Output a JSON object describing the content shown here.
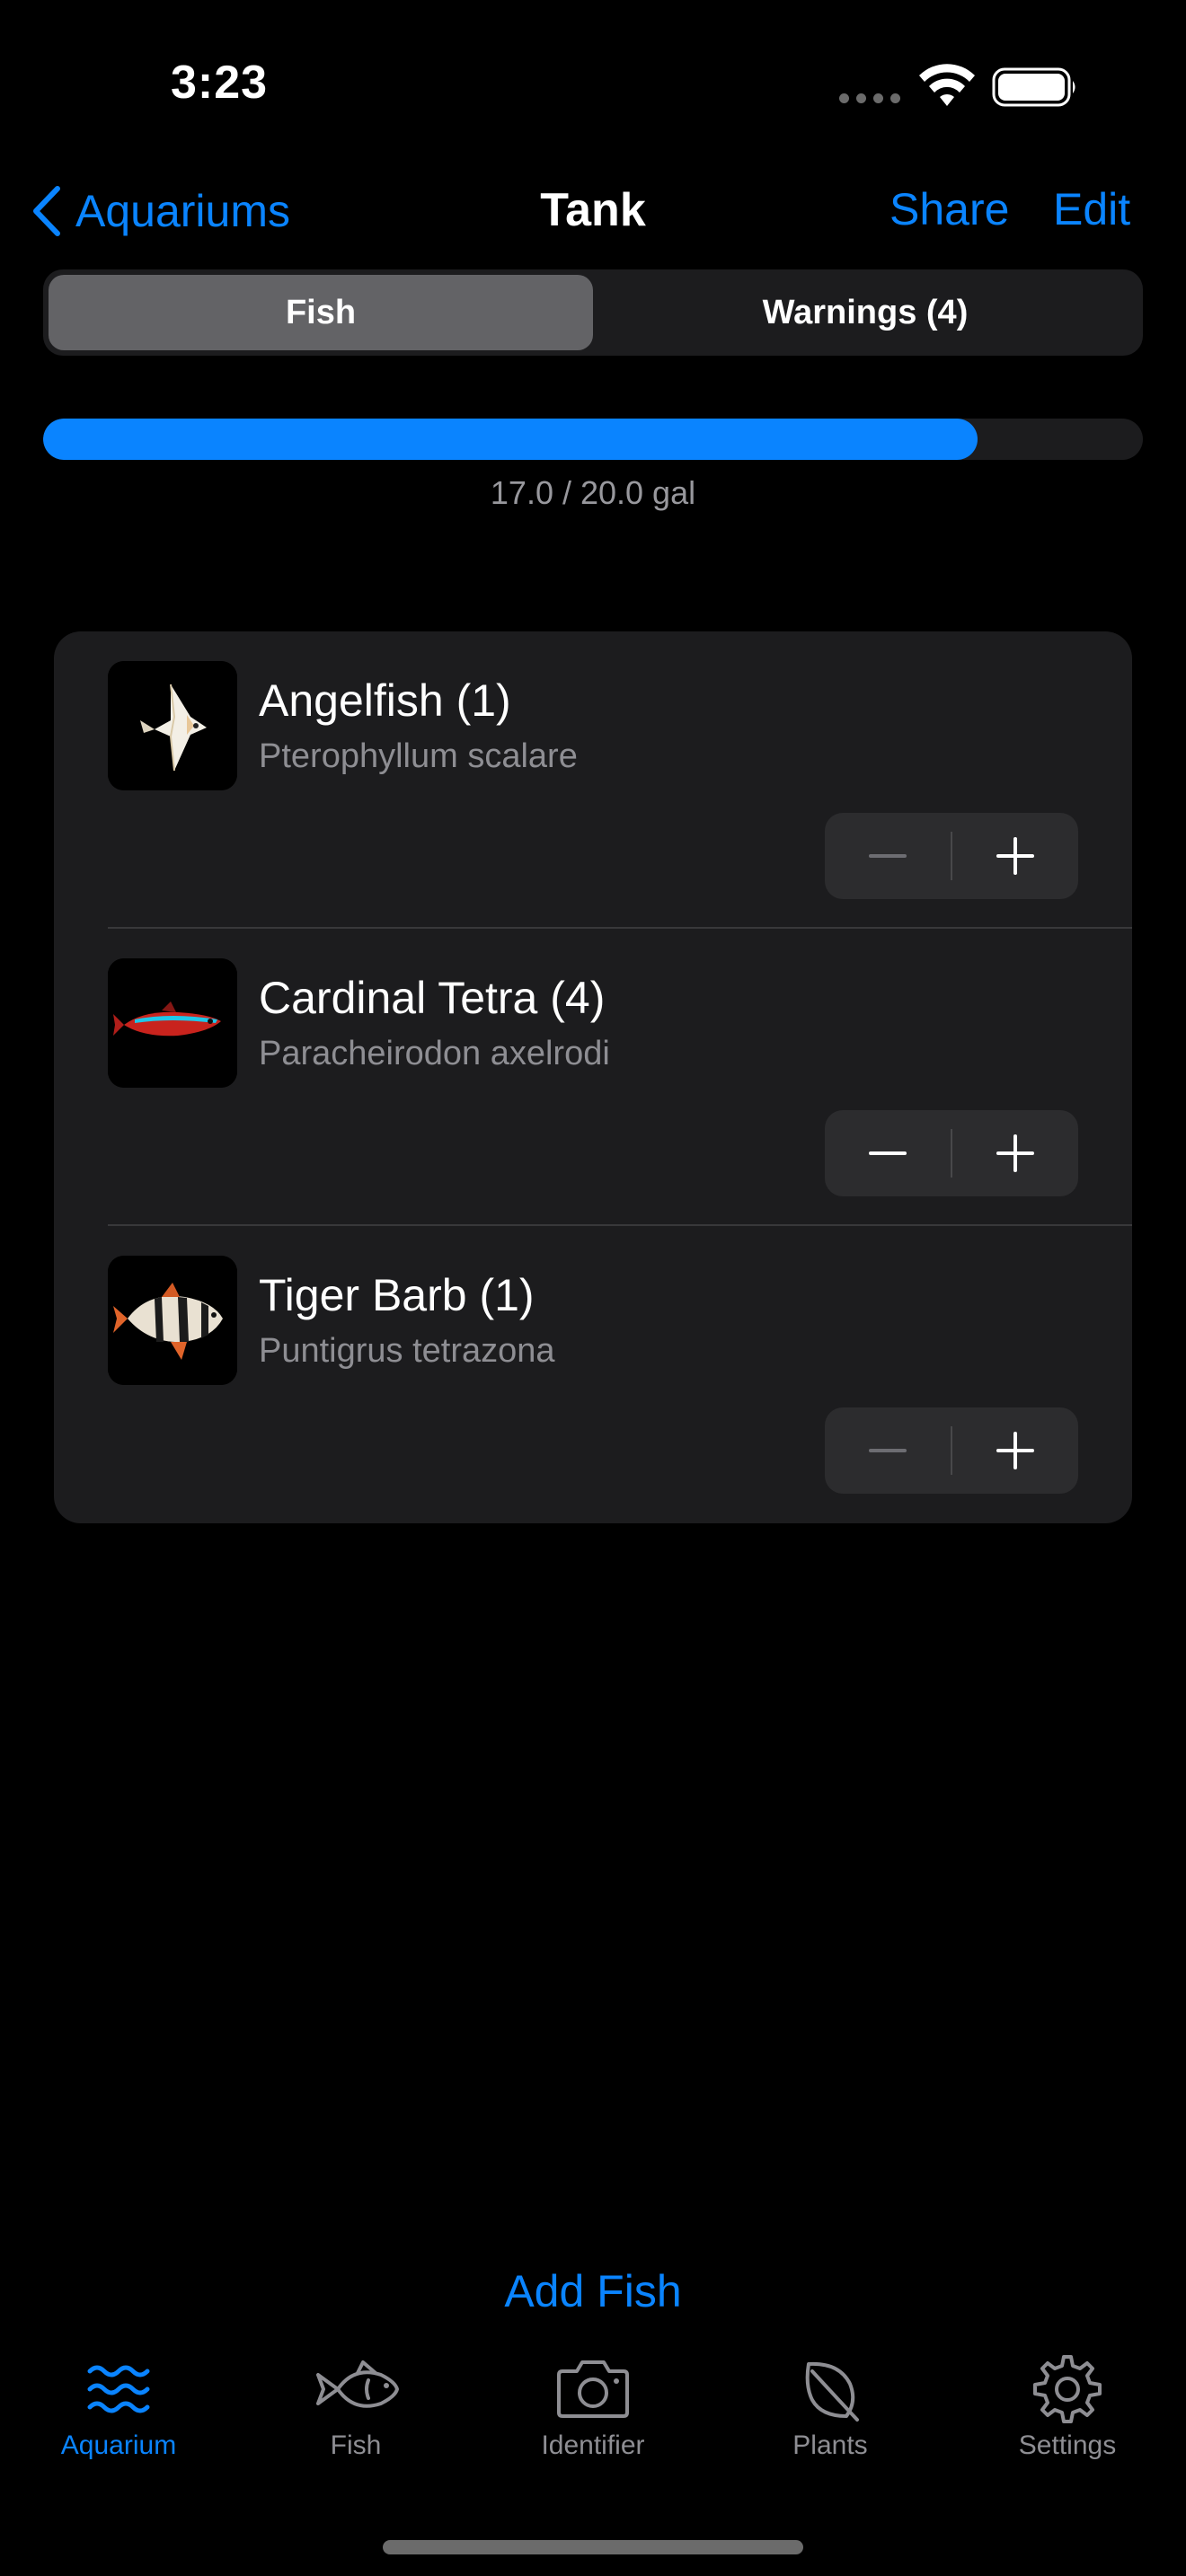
{
  "status_bar": {
    "time": "3:23"
  },
  "nav": {
    "back_label": "Aquariums",
    "title": "Tank",
    "share_label": "Share",
    "edit_label": "Edit"
  },
  "segments": [
    {
      "label": "Fish",
      "selected": true
    },
    {
      "label": "Warnings (4)",
      "selected": false
    }
  ],
  "capacity": {
    "text": "17.0 / 20.0 gal",
    "used": 17.0,
    "total": 20.0,
    "fraction": 0.85
  },
  "fish": [
    {
      "name": "Angelfish (1)",
      "scientific": "Pterophyllum scalare",
      "thumbnail": "angelfish-image",
      "decrement_enabled": false
    },
    {
      "name": "Cardinal Tetra (4)",
      "scientific": "Paracheirodon axelrodi",
      "thumbnail": "cardinal-tetra-image",
      "decrement_enabled": true
    },
    {
      "name": "Tiger Barb (1)",
      "scientific": "Puntigrus tetrazona",
      "thumbnail": "tiger-barb-image",
      "decrement_enabled": false
    }
  ],
  "add_fish_label": "Add Fish",
  "tabs": [
    {
      "label": "Aquarium",
      "icon": "waves-icon",
      "selected": true
    },
    {
      "label": "Fish",
      "icon": "fish-icon",
      "selected": false
    },
    {
      "label": "Identifier",
      "icon": "camera-icon",
      "selected": false
    },
    {
      "label": "Plants",
      "icon": "leaf-icon",
      "selected": false
    },
    {
      "label": "Settings",
      "icon": "gear-icon",
      "selected": false
    }
  ],
  "colors": {
    "accent": "#0a84ff",
    "background": "#000000",
    "card": "#1c1c1e",
    "secondary_text": "#8e8e93"
  }
}
